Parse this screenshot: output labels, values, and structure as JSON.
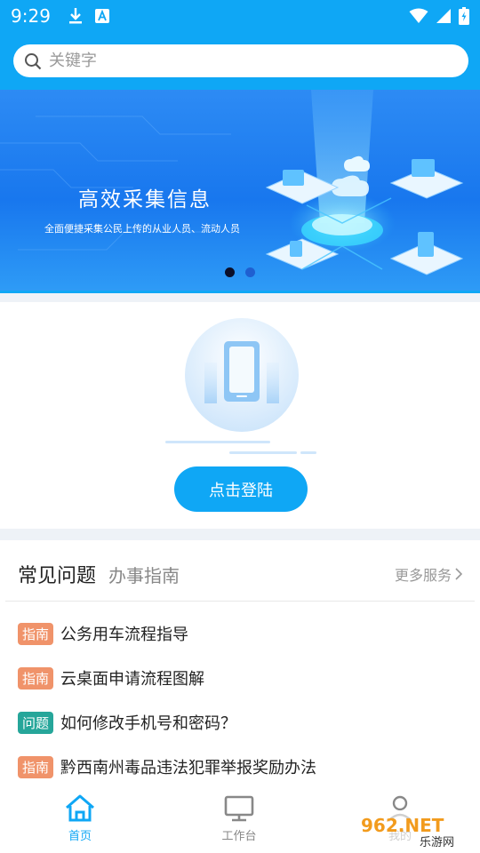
{
  "status_bar": {
    "time": "9:29"
  },
  "search": {
    "placeholder": "关键字"
  },
  "banner": {
    "title": "高效采集信息",
    "subtitle": "全面便捷采集公民上传的从业人员、流动人员"
  },
  "login": {
    "button_label": "点击登陆"
  },
  "faq": {
    "tab_active": "常见问题",
    "tab_inactive": "办事指南",
    "more_label": "更多服务",
    "items": [
      {
        "tag": "指南",
        "text": "公务用车流程指导"
      },
      {
        "tag": "指南",
        "text": "云桌面申请流程图解"
      },
      {
        "tag": "问题",
        "text": "如何修改手机号和密码？"
      },
      {
        "tag": "指南",
        "text": "黔西南州毒品违法犯罪举报奖励办法"
      }
    ]
  },
  "bottom_nav": [
    {
      "label": "首页",
      "icon": "home-icon",
      "active": true
    },
    {
      "label": "工作台",
      "icon": "monitor-icon",
      "active": false
    },
    {
      "label": "我的",
      "icon": "person-icon",
      "active": false
    }
  ],
  "watermark": {
    "text": "962.NET",
    "sub": "乐游网"
  },
  "colors": {
    "primary": "#0fa7f5",
    "guide_tag": "#f0936a",
    "question_tag": "#26a69a"
  }
}
